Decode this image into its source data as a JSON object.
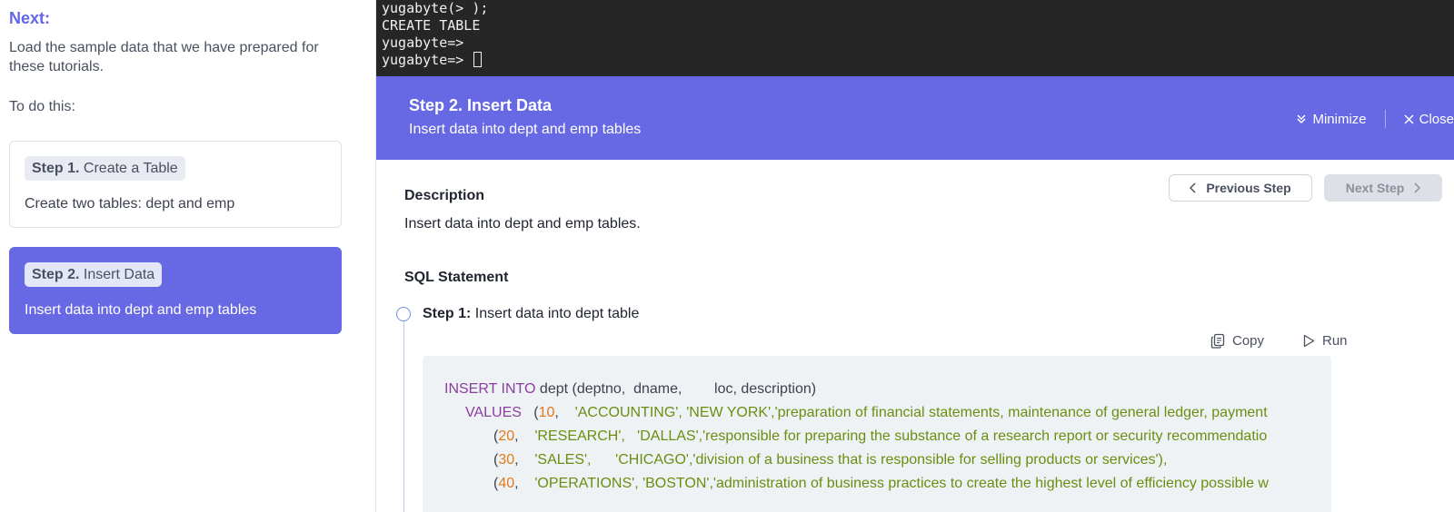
{
  "left_panel": {
    "next_label": "Next:",
    "intro": "Load the sample data that we have prepared for these tutorials.",
    "todo": "To do this:",
    "steps": [
      {
        "prefix": "Step 1.",
        "title": "Create a Table",
        "desc": "Create two tables: dept and emp"
      },
      {
        "prefix": "Step 2.",
        "title": "Insert Data",
        "desc": "Insert data into dept and emp tables"
      }
    ]
  },
  "terminal": {
    "lines": [
      "yugabyte(> );",
      "CREATE TABLE",
      "yugabyte=>",
      "yugabyte=> "
    ]
  },
  "banner": {
    "title": "Step 2. Insert Data",
    "subtitle": "Insert data into dept and emp tables",
    "minimize": "Minimize",
    "close": "Close"
  },
  "nav": {
    "previous": "Previous Step",
    "next": "Next Step"
  },
  "description": {
    "heading": "Description",
    "text": "Insert data into dept and emp tables."
  },
  "sql": {
    "heading": "SQL Statement",
    "step_prefix": "Step 1:",
    "step_title": "Insert data into dept table",
    "copy": "Copy",
    "run": "Run"
  },
  "code": {
    "line1": {
      "kw": "INSERT INTO",
      "rest": " dept (deptno,  dname,        loc, description)"
    },
    "values_kw": "VALUES",
    "rows": [
      {
        "open": "(",
        "num": "10",
        "sep": ",    ",
        "str": "'ACCOUNTING', 'NEW YORK','preparation of financial statements, maintenance of general ledger, payment"
      },
      {
        "open": "(",
        "num": "20",
        "sep": ",    ",
        "str": "'RESEARCH',   'DALLAS','responsible for preparing the substance of a research report or security recommendatio"
      },
      {
        "open": "(",
        "num": "30",
        "sep": ",    ",
        "str": "'SALES',      'CHICAGO','division of a business that is responsible for selling products or services'),"
      },
      {
        "open": "(",
        "num": "40",
        "sep": ",    ",
        "str": "'OPERATIONS', 'BOSTON','administration of business practices to create the highest level of efficiency possible w"
      }
    ]
  },
  "colors": {
    "accent": "#6769e4",
    "keyword": "#8a3f9e",
    "number": "#e37a1a",
    "string": "#6b8e10",
    "terminal_bg": "#262626"
  }
}
